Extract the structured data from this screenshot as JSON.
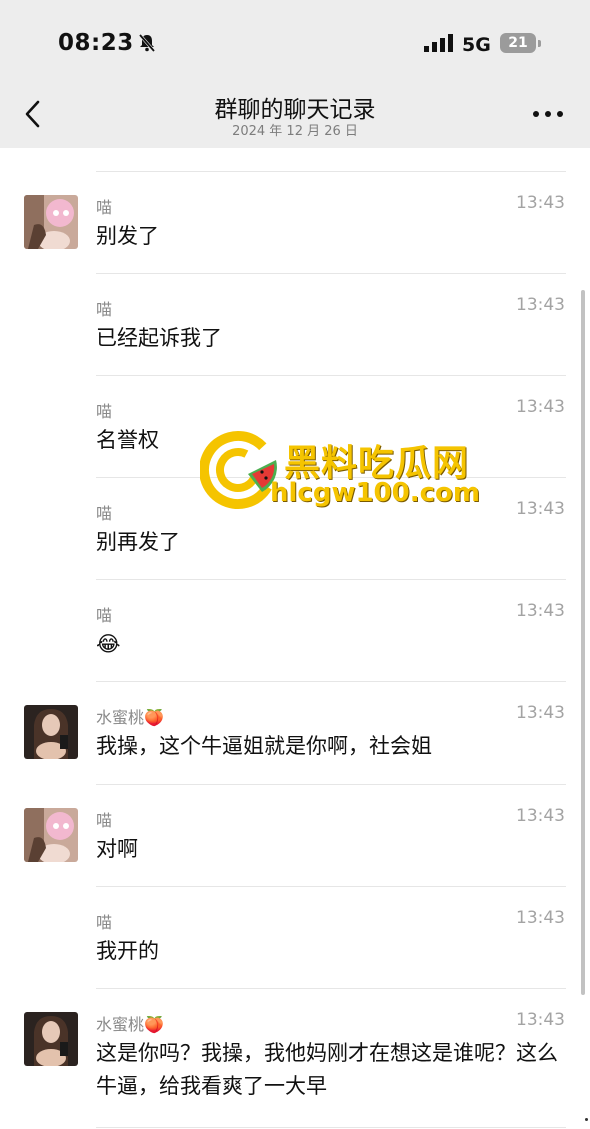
{
  "status_bar": {
    "time": "08:23",
    "network": "5G",
    "battery": "21"
  },
  "header": {
    "title": "群聊的聊天记录",
    "subtitle": "2024 年 12 月 26 日"
  },
  "messages": [
    {
      "sender": "喵",
      "time": "13:43",
      "text": "别发了",
      "has_avatar": true,
      "avatar": "pink-avatar"
    },
    {
      "sender": "喵",
      "time": "13:43",
      "text": "已经起诉我了",
      "has_avatar": false
    },
    {
      "sender": "喵",
      "time": "13:43",
      "text": "名誉权",
      "has_avatar": false
    },
    {
      "sender": "喵",
      "time": "13:43",
      "text": "别再发了",
      "has_avatar": false
    },
    {
      "sender": "喵",
      "time": "13:43",
      "text": "😂",
      "has_avatar": false
    },
    {
      "sender": "水蜜桃🍑",
      "time": "13:43",
      "text": "我操，这个牛逼姐就是你啊，社会姐",
      "has_avatar": true,
      "avatar": "dark-avatar"
    },
    {
      "sender": "喵",
      "time": "13:43",
      "text": "对啊",
      "has_avatar": true,
      "avatar": "pink-avatar"
    },
    {
      "sender": "喵",
      "time": "13:43",
      "text": "我开的",
      "has_avatar": false
    },
    {
      "sender": "水蜜桃🍑",
      "time": "13:43",
      "text": "这是你吗？我操，我他妈刚才在想这是谁呢？这么牛逼，给我看爽了一大早",
      "has_avatar": true,
      "avatar": "dark-avatar"
    }
  ],
  "watermark": {
    "name": "黑料吃瓜网",
    "url": "hlcgw100.com"
  },
  "colors": {
    "header_bg": "#ededed",
    "watermark": "#f5c400"
  }
}
